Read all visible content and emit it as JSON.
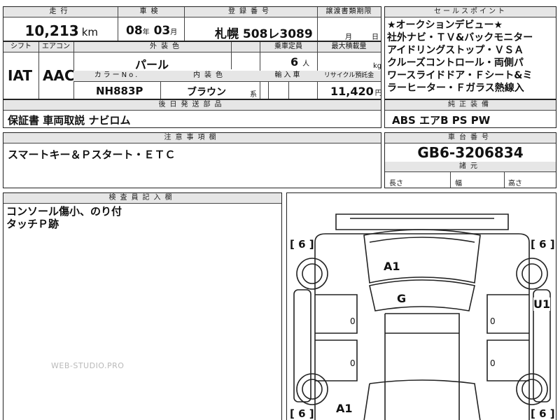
{
  "top_header": {
    "mileage_label": "走行",
    "inspection_label": "車検",
    "registration_label": "登録番号",
    "transfer_deadline_label": "譲渡書類期限",
    "selling_points_label": "セールスポイント"
  },
  "mileage": {
    "value": "10,213",
    "unit": "km"
  },
  "inspection": {
    "year": "08",
    "year_unit": "年",
    "month": "03",
    "month_unit": "月"
  },
  "registration": {
    "value": "札幌 508レ3089"
  },
  "transfer_deadline": {
    "month_unit": "月",
    "day_unit": "日"
  },
  "second_header": {
    "shift_label": "シフト",
    "aircon_label": "エアコン",
    "exterior_color_label": "外装色",
    "capacity_label": "乗車定員",
    "max_load_label": "最大積載量"
  },
  "shift": "IAT",
  "aircon": "AAC",
  "exterior_color": "パール",
  "capacity": {
    "value": "6",
    "unit": "人"
  },
  "max_load": {
    "unit": "kg"
  },
  "third_header": {
    "color_no_label": "カラーNo.",
    "interior_color_label": "内装色",
    "import_label": "輸入車",
    "recycle_label": "リサイクル預託金"
  },
  "color_no": "NH883P",
  "interior_color": {
    "value": "ブラウン",
    "suffix": "系"
  },
  "recycle_fee": {
    "value": "11,420",
    "unit": "円"
  },
  "selling_points": {
    "lines": [
      "★オークションデビュー★",
      "社外ナビ・ＴＶ&バックモニター",
      "アイドリングストップ・ＶＳＡ",
      "クルーズコントロール・両側パ",
      "ワースライドドア・Ｆシート&ミ",
      "ラーヒーター・Ｆガラス熱線入"
    ]
  },
  "standard_equipment": {
    "label": "純正装備",
    "value": "ABS エアB PS PW"
  },
  "later_shipping": {
    "label": "後日発送部品",
    "value": "保証書 車両取説 ナビロム"
  },
  "notes": {
    "label": "注意事項欄",
    "value": "スマートキー＆Ｐスタート・ＥＴＣ"
  },
  "chassis": {
    "label": "車台番号",
    "value": "GB6-3206834"
  },
  "dimensions": {
    "label": "諸元",
    "length_label": "長さ",
    "width_label": "幅",
    "height_label": "高さ"
  },
  "inspector": {
    "label": "検査員記入欄",
    "lines": [
      "コンソール傷小、のり付",
      "タッチＰ跡"
    ]
  },
  "diagram": {
    "front_left_tire": "[ 6 ]",
    "front_right_tire": "[ 6 ]",
    "rear_left_tire": "[ 6 ]",
    "rear_right_tire": "[ 6 ]",
    "hood_mark": "A1",
    "windshield_mark": "G",
    "right_side_mark": "U1",
    "rear_mark": "A1",
    "door_marks": [
      "0",
      "0",
      "0",
      "0"
    ]
  },
  "watermark": "WEB-STUDIO.PRO"
}
